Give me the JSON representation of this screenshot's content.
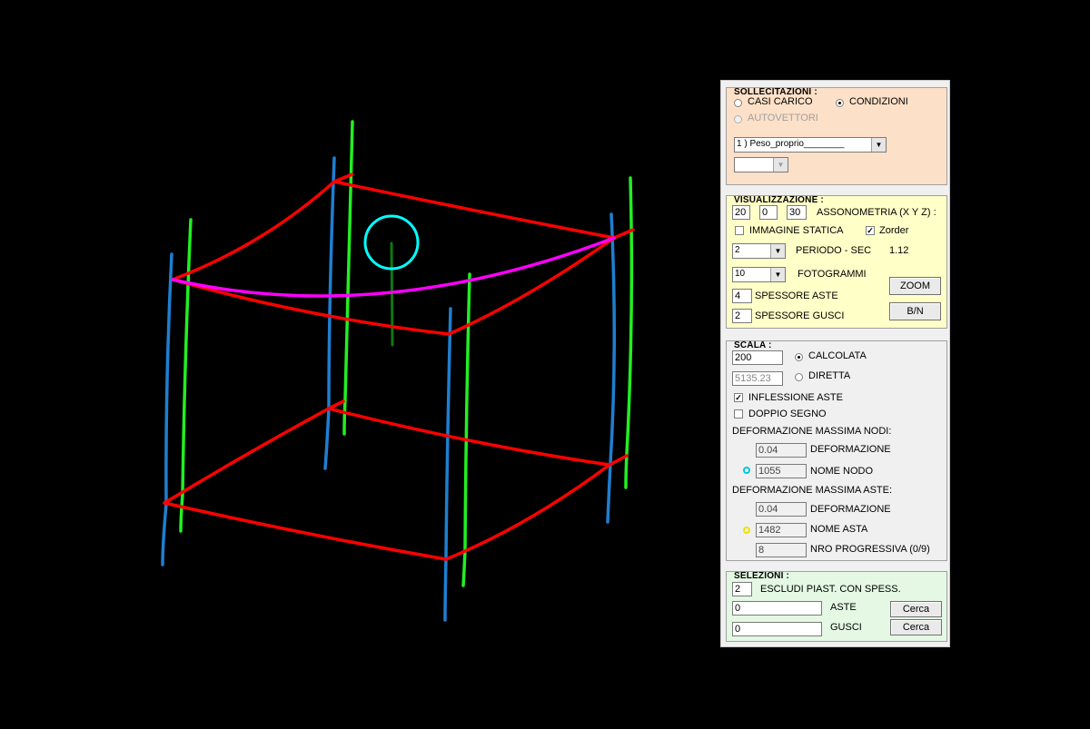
{
  "viewport": {
    "colors": {
      "deformed_beams": "#ff0000",
      "max_beam": "#ff00ff",
      "columns_a": "#1e7fd0",
      "columns_b": "#22ee22",
      "node_marker": "#00ffff",
      "inner_post": "#117711"
    }
  },
  "panel": {
    "sollecitazioni": {
      "title": "SOLLECITAZIONI :",
      "casi_carico": "CASI CARICO",
      "condizioni": "CONDIZIONI",
      "autovettori": "AUTOVETTORI",
      "load_select": "1 ) Peso_proprio________",
      "sub_select": ""
    },
    "visualizzazione": {
      "title": "VISUALIZZAZIONE :",
      "ax_x": "20",
      "ax_y": "0",
      "ax_z": "30",
      "assonometria_label": "ASSONOMETRIA (X Y Z) :",
      "immagine_statica": "IMMAGINE STATICA",
      "zorder": "Zorder",
      "periodo_value": "2",
      "periodo_label": "PERIODO - SEC",
      "periodo_sec": "1.12",
      "fotogrammi_value": "10",
      "fotogrammi_label": "FOTOGRAMMI",
      "spessore_aste_value": "4",
      "spessore_aste_label": "SPESSORE ASTE",
      "spessore_gusci_value": "2",
      "spessore_gusci_label": "SPESSORE GUSCI",
      "zoom_button": "ZOOM",
      "bn_button": "B/N"
    },
    "scala": {
      "title": "SCALA :",
      "calcolata_value": "200",
      "calcolata_label": "CALCOLATA",
      "diretta_value": "5135.23",
      "diretta_label": "DIRETTA",
      "inflessione_aste": "INFLESSIONE ASTE",
      "doppio_segno": "DOPPIO SEGNO",
      "def_max_nodi": "DEFORMAZIONE MASSIMA NODI:",
      "nodi_def_value": "0.04",
      "nodi_def_label": "DEFORMAZIONE",
      "nodo_value": "1055",
      "nodo_label": "NOME NODO",
      "def_max_aste": "DEFORMAZIONE MASSIMA ASTE:",
      "aste_def_value": "0.04",
      "aste_def_label": "DEFORMAZIONE",
      "asta_value": "1482",
      "asta_label": "NOME ASTA",
      "progressiva_value": "8",
      "progressiva_label": "NRO PROGRESSIVA (0/9)",
      "node_dot_color": "#00c8e0",
      "asta_dot_color": "#f0e000"
    },
    "selezioni": {
      "title": "SELEZIONI :",
      "escludi_value": "2",
      "escludi_label": "ESCLUDI PIAST. CON SPESS.",
      "aste_value": "0",
      "aste_label": "ASTE",
      "gusci_value": "0",
      "gusci_label": "GUSCI",
      "cerca_aste": "Cerca",
      "cerca_gusci": "Cerca"
    },
    "colors": {
      "sollecitazioni_bg": "#fde0c8",
      "visualizzazione_bg": "#ffffc8",
      "scala_bg": "#f0f0f0",
      "selezioni_bg": "#e4f8e4"
    }
  }
}
